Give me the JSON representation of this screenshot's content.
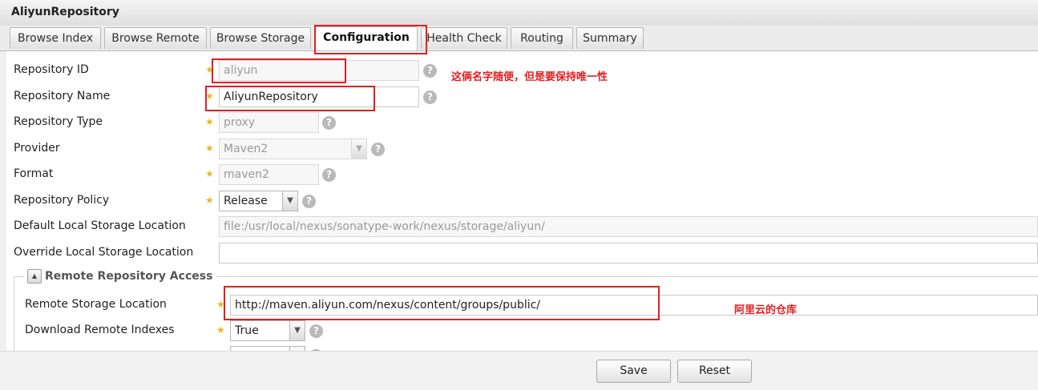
{
  "window": {
    "title": "AliyunRepository"
  },
  "tabs": [
    {
      "label": "Browse Index"
    },
    {
      "label": "Browse Remote"
    },
    {
      "label": "Browse Storage"
    },
    {
      "label": "Configuration",
      "active": true
    },
    {
      "label": "Health Check"
    },
    {
      "label": "Routing"
    },
    {
      "label": "Summary"
    }
  ],
  "form": {
    "repo_id": {
      "label": "Repository ID",
      "value": "aliyun"
    },
    "repo_name": {
      "label": "Repository Name",
      "value": "AliyunRepository"
    },
    "repo_type": {
      "label": "Repository Type",
      "value": "proxy"
    },
    "provider": {
      "label": "Provider",
      "value": "Maven2"
    },
    "format": {
      "label": "Format",
      "value": "maven2"
    },
    "policy": {
      "label": "Repository Policy",
      "value": "Release"
    },
    "default_storage": {
      "label": "Default Local Storage Location",
      "value": "file:/usr/local/nexus/sonatype-work/nexus/storage/aliyun/"
    },
    "override_storage": {
      "label": "Override Local Storage Location",
      "value": ""
    }
  },
  "remote_section": {
    "title": "Remote Repository Access",
    "remote_url": {
      "label": "Remote Storage Location",
      "value": "http://maven.aliyun.com/nexus/content/groups/public/"
    },
    "download_indexes": {
      "label": "Download Remote Indexes",
      "value": "True"
    }
  },
  "annotations": {
    "name_note": "这俩名字随便，但是要保持唯一性",
    "url_note": "阿里云的仓库"
  },
  "footer": {
    "save": "Save",
    "reset": "Reset"
  },
  "colors": {
    "annotation": "#e02020",
    "required_star": "#e8b820"
  },
  "icons": {
    "required": "star-icon",
    "help": "question-mark-icon",
    "dropdown": "chevron-down-icon",
    "collapse": "caret-up-icon"
  }
}
